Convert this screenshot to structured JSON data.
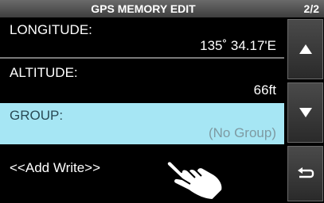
{
  "header": {
    "title": "GPS MEMORY EDIT",
    "page_indicator": "2/2"
  },
  "list": {
    "items": [
      {
        "label": "LONGITUDE:",
        "value": "135˚ 34.17'E"
      },
      {
        "label": "ALTITUDE:",
        "value": "66ft"
      },
      {
        "label": "GROUP:",
        "value": "(No Group)",
        "selected": true
      },
      {
        "label": "<<Add Write>>"
      }
    ]
  },
  "sidebar": {
    "up_icon": "triangle-up-icon",
    "down_icon": "triangle-down-icon",
    "back_icon": "return-arrow-icon"
  },
  "colors": {
    "screen_bg": "#000000",
    "selected_row": "#a6e6f4",
    "selected_value": "#7e9aa2",
    "titlebar": "#555555"
  }
}
